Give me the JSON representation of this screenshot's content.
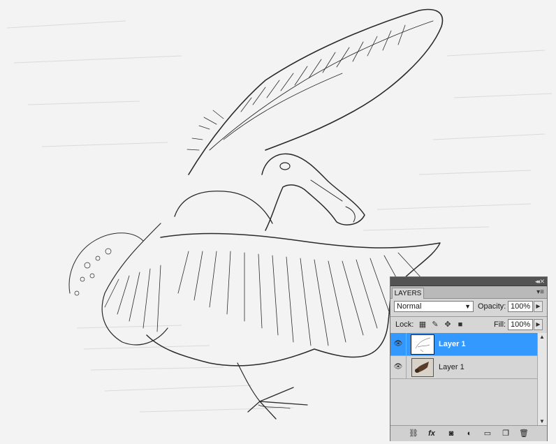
{
  "panel": {
    "tab_label": "LAYERS",
    "blend_mode": "Normal",
    "opacity_label": "Opacity:",
    "opacity_value": "100%",
    "lock_label": "Lock:",
    "fill_label": "Fill:",
    "fill_value": "100%",
    "layers": [
      {
        "name": "Layer 1",
        "selected": true,
        "visible": true,
        "thumbnail": "sketch"
      },
      {
        "name": "Layer 1",
        "selected": false,
        "visible": true,
        "thumbnail": "photo"
      }
    ],
    "lock_icons": [
      "lock-transparent-pixels-icon",
      "lock-image-pixels-icon",
      "lock-position-icon",
      "lock-all-icon"
    ],
    "bottom_icons": [
      "link-layers-icon",
      "fx-icon",
      "layer-mask-icon",
      "adjustment-layer-icon",
      "new-group-icon",
      "new-layer-icon",
      "trash-icon"
    ],
    "colors": {
      "selected_row": "#3399ff",
      "panel_bg": "#d6d6d6",
      "titlebar": "#535353"
    }
  }
}
